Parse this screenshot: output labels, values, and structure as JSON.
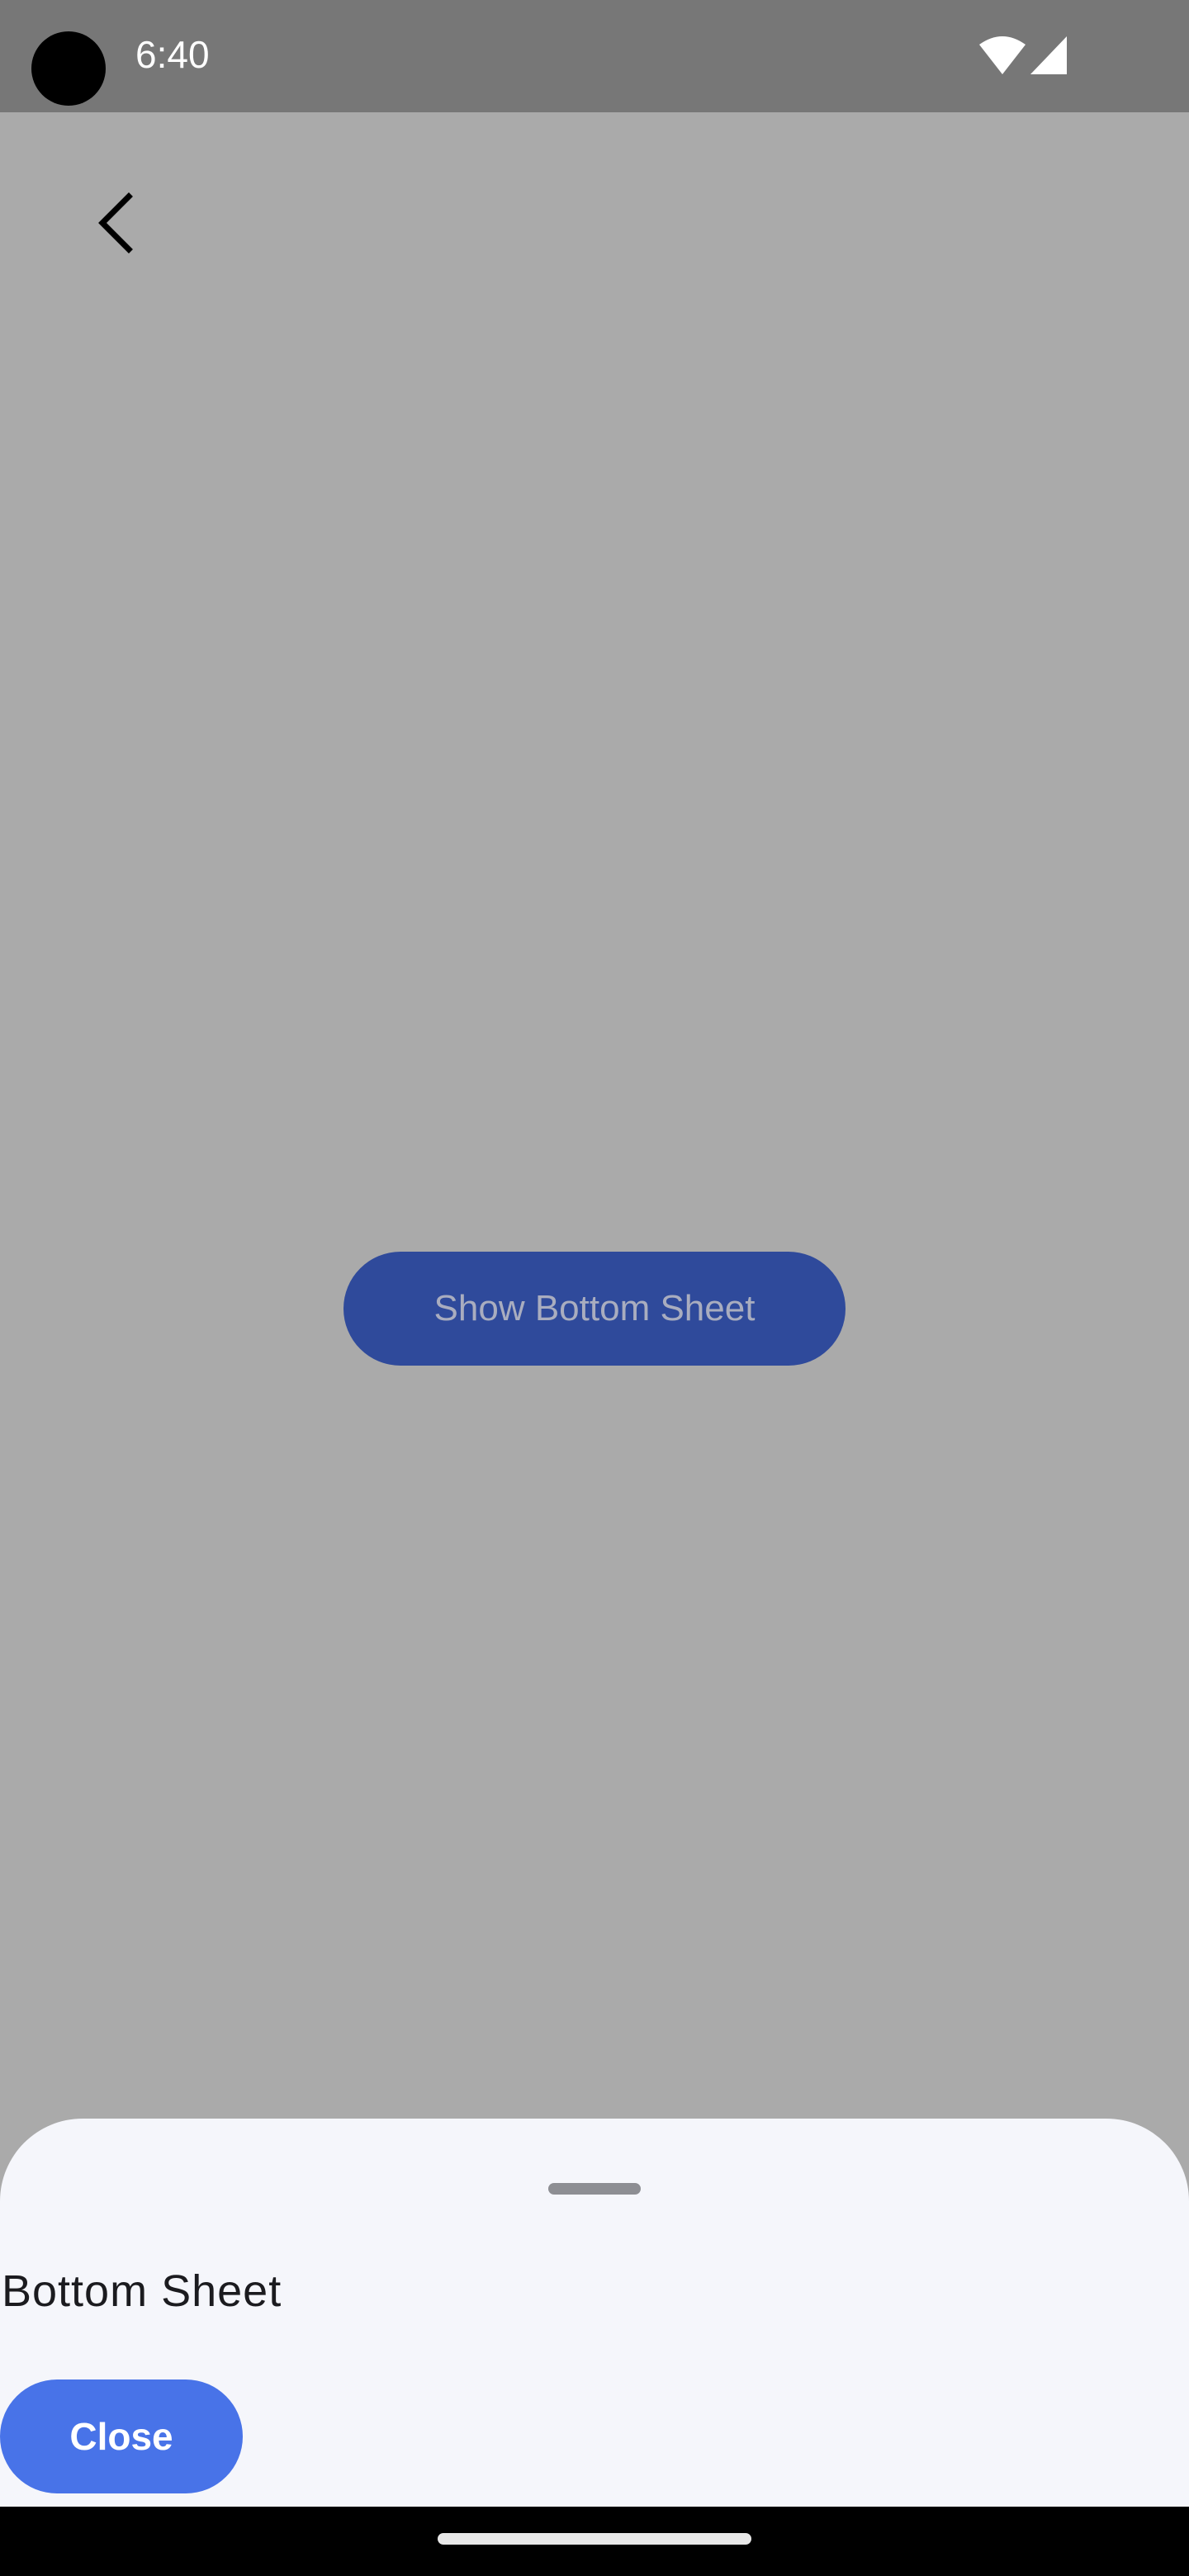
{
  "status_bar": {
    "time": "6:40",
    "icons": [
      "wifi-icon",
      "signal-icon"
    ]
  },
  "app_bar": {
    "back_icon": "chevron-left-icon"
  },
  "main": {
    "show_sheet_label": "Show Bottom Sheet"
  },
  "bottom_sheet": {
    "title": "Bottom Sheet",
    "close_label": "Close"
  },
  "colors": {
    "scrim": "#aaaaaa",
    "status_bar": "#777777",
    "primary_dimmed": "#2f4a9b",
    "primary": "#4873e8",
    "sheet_background": "#f5f6fb"
  }
}
